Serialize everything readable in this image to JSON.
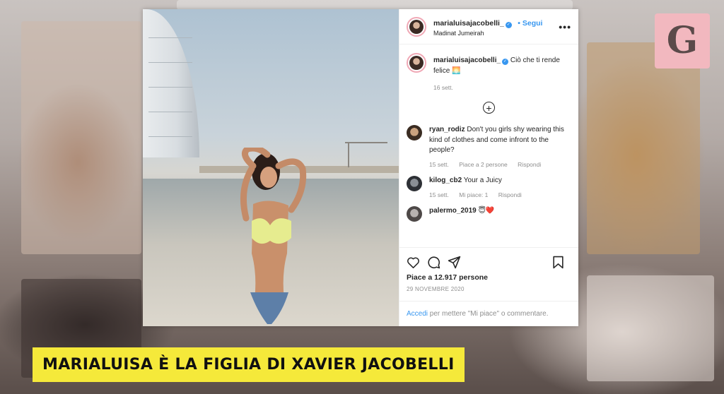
{
  "post": {
    "username": "marialuisajacobelli_",
    "follow_label": "Segui",
    "location": "Madinat Jumeirah",
    "more_label": "•••",
    "caption": {
      "username": "marialuisajacobelli_",
      "text": "Ciò che ti rende felice 🌅",
      "time": "16 sett."
    },
    "comments": [
      {
        "username": "ryan_rodiz",
        "text": "Don't you girls shy wearing this kind of clothes and come infront to the people?",
        "time": "15 sett.",
        "likes": "Piace a 2 persone",
        "reply": "Rispondi"
      },
      {
        "username": "kilog_cb2",
        "text": "Your a Juicy",
        "time": "15 sett.",
        "likes": "Mi piace: 1",
        "reply": "Rispondi"
      },
      {
        "username": "palermo_2019",
        "text": "😇❤️",
        "time": "",
        "likes": "",
        "reply": ""
      }
    ],
    "likes_label": "Piace a 12.917 persone",
    "date": "29 NOVEMBRE 2020",
    "login_link": "Accedi",
    "login_text": " per mettere \"Mi piace\" o commentare."
  },
  "overlay": {
    "logo_letter": "G",
    "banner": "MARIALUISA È LA FIGLIA DI XAVIER JACOBELLI"
  },
  "colors": {
    "link": "#3897f0",
    "banner_bg": "#f5e93a",
    "logo_bg": "#f2b8bf"
  }
}
